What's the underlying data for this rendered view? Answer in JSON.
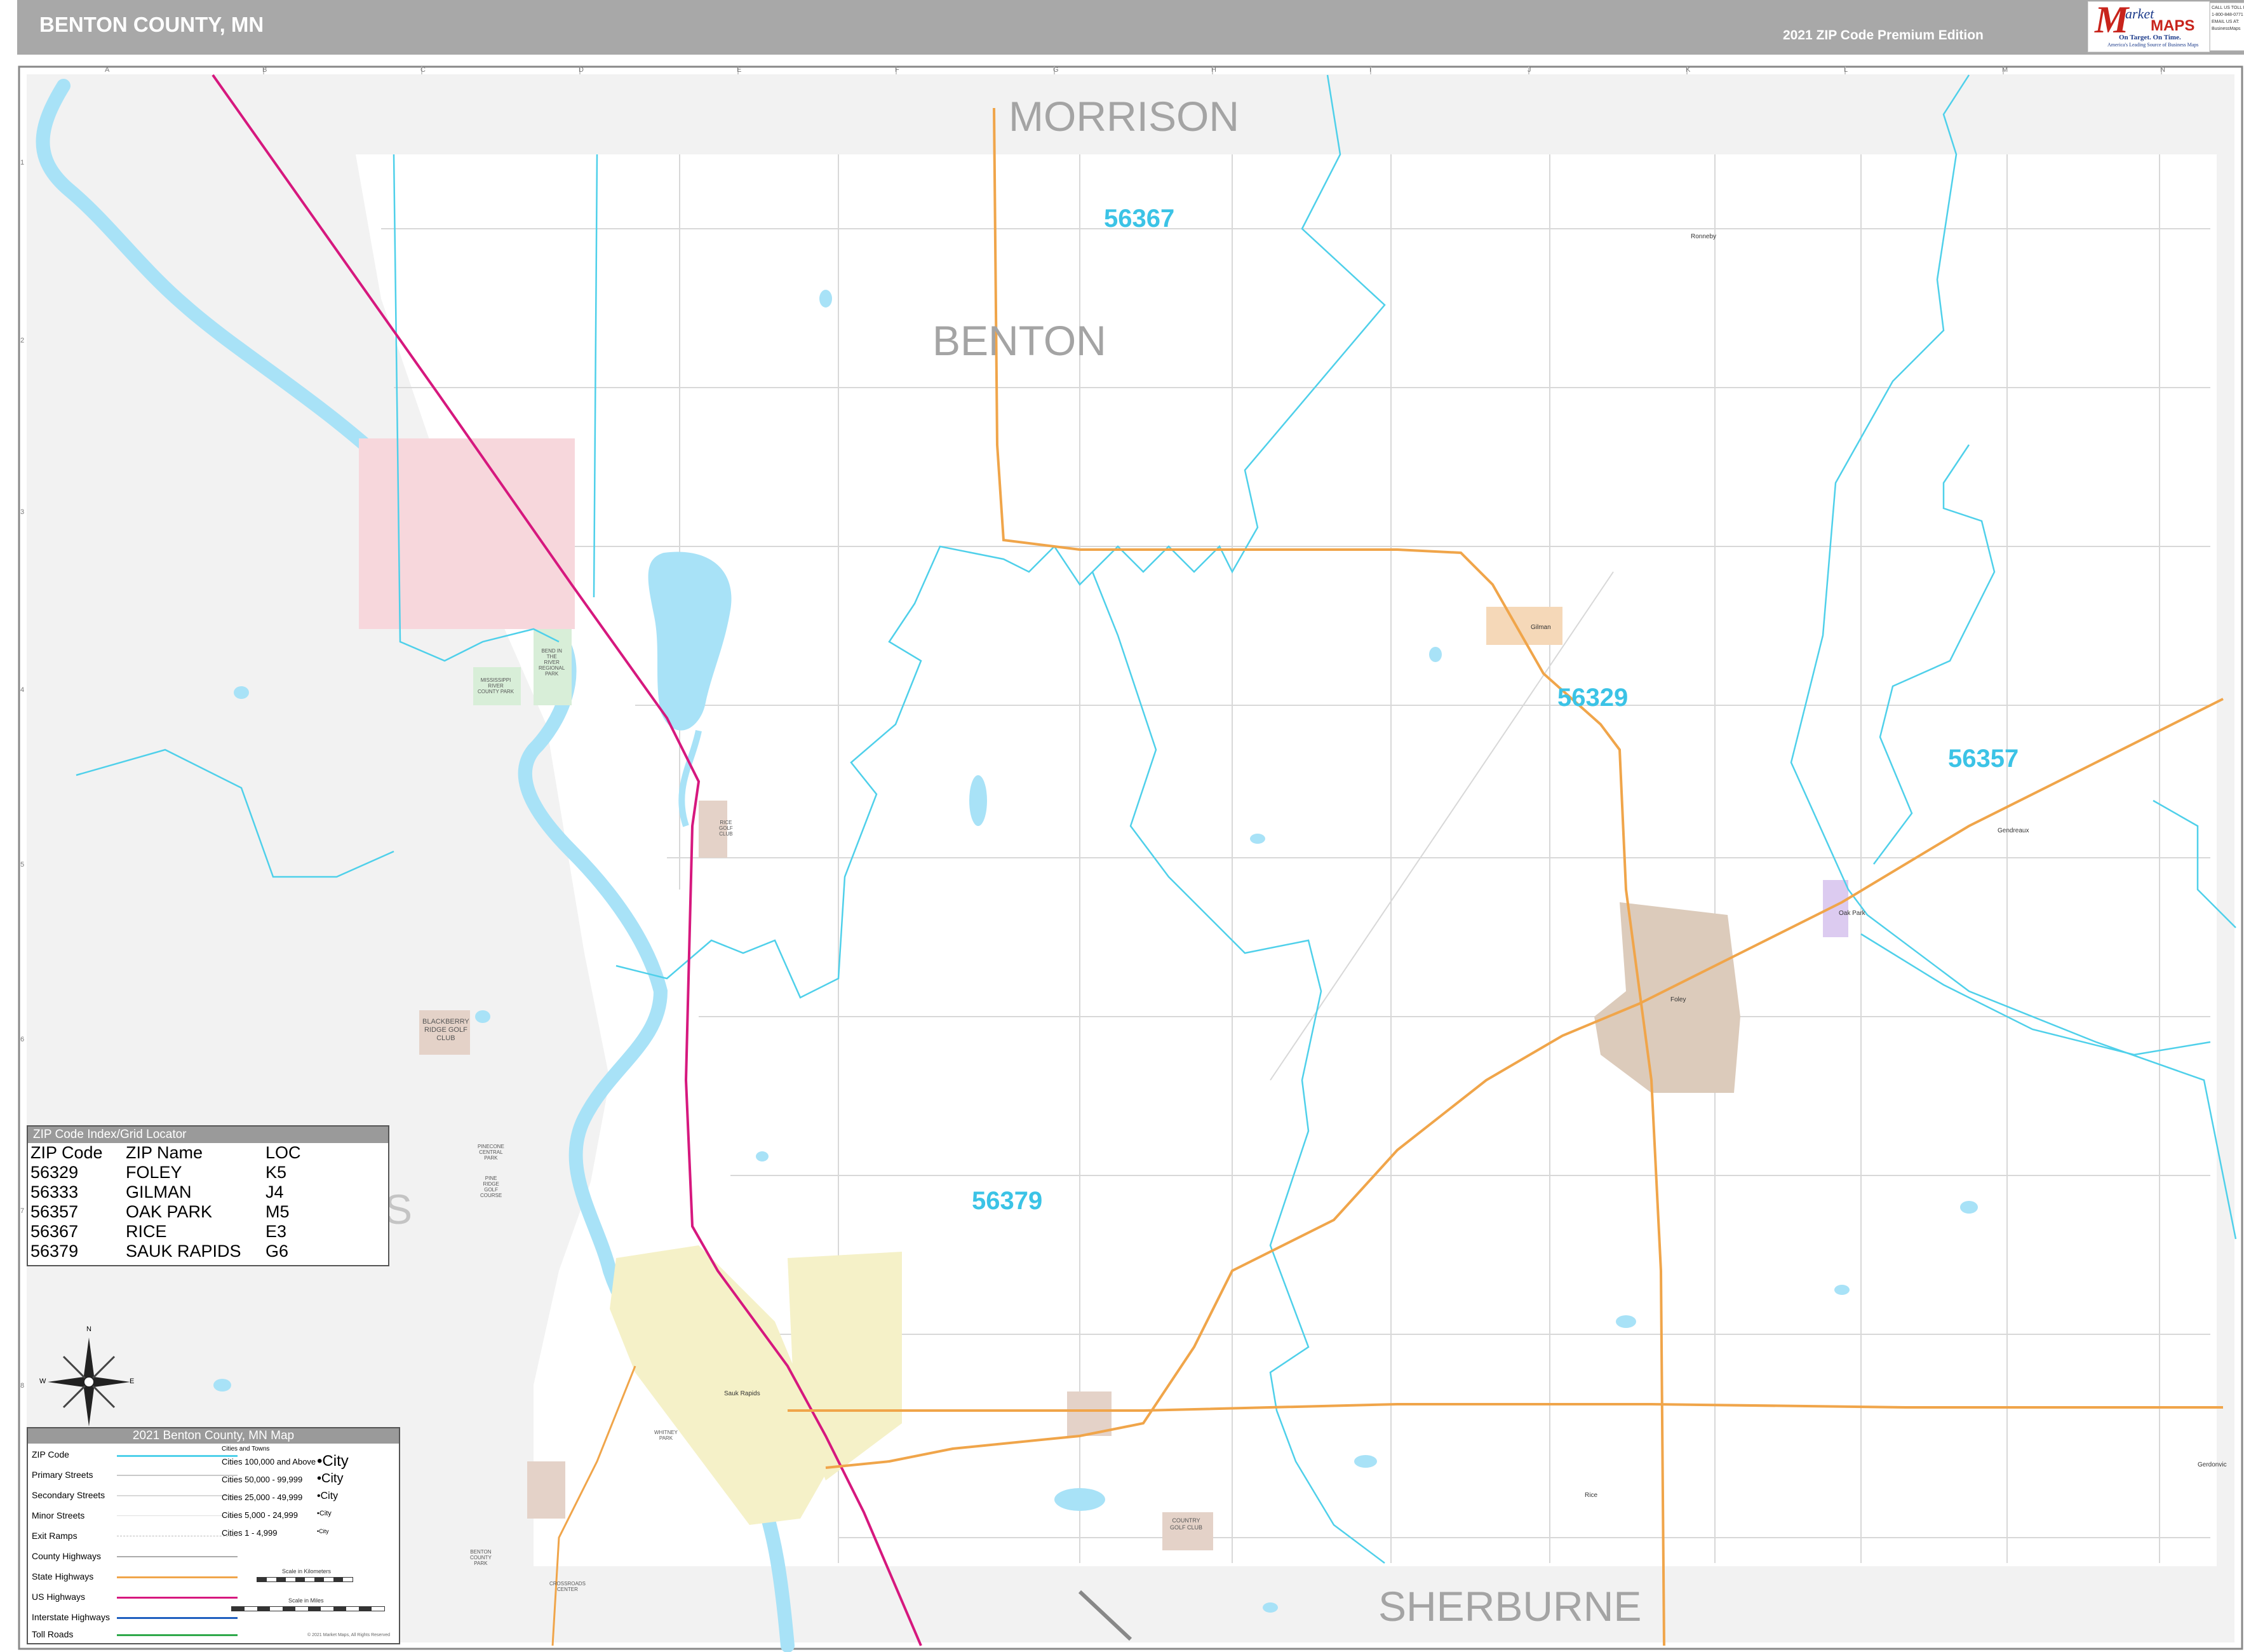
{
  "header": {
    "title": "BENTON COUNTY, MN",
    "edition": "2021 ZIP Code Premium Edition",
    "logo": {
      "m": "M",
      "arket": "arket",
      "maps": "MAPS",
      "tag1": "On Target.  On Time.",
      "tag2": "America's Leading Source of Business Maps"
    },
    "contact_lines": [
      "CALL US TOLL FREE",
      "1-800-848-0771",
      "EMAIL US AT:",
      "BusinessMaps"
    ]
  },
  "grid": {
    "columns": [
      "A",
      "B",
      "C",
      "D",
      "E",
      "F",
      "G",
      "H",
      "I",
      "J",
      "K",
      "L",
      "M",
      "N"
    ],
    "rows": [
      "1",
      "2",
      "3",
      "4",
      "5",
      "6",
      "7",
      "8"
    ]
  },
  "regions": {
    "morrison": "MORRISON",
    "benton": "BENTON",
    "sherburne": "SHERBURNE",
    "stearns_fragment": "S"
  },
  "zips": {
    "z56367": "56367",
    "z56329": "56329",
    "z56357": "56357",
    "z56379": "56379"
  },
  "places": {
    "blackberry": [
      "BLACKBERRY",
      "RIDGE GOLF",
      "CLUB"
    ],
    "sauk_rapids_town": "Sauk Rapids",
    "foley_town": "Foley",
    "gilman_town": "Gilman",
    "ronneby": "Ronneby",
    "oak_park_town": "Oak Park",
    "rice_town": "Rice",
    "gerdonvic": "Gerdonvic",
    "gendreaux": "Gendreaux",
    "country_golf": [
      "COUNTRY",
      "GOLF CLUB"
    ],
    "mississippi_park": [
      "MISSISSIPPI",
      "RIVER",
      "COUNTY PARK"
    ],
    "bend_river": [
      "BEND IN",
      "THE",
      "RIVER",
      "REGIONAL",
      "PARK"
    ],
    "pinecone": [
      "PINECONE",
      "CENTRAL",
      "PARK"
    ],
    "pine_ridge": [
      "PINE",
      "RIDGE",
      "GOLF",
      "COURSE"
    ],
    "whitney_park": [
      "WHITNEY",
      "PARK"
    ],
    "benton_park": [
      "BENTON",
      "COUNTY",
      "PARK"
    ],
    "crossroads": [
      "CROSSROADS",
      "CENTER"
    ],
    "golf_rice": [
      "RICE",
      "GOLF",
      "CLUB"
    ]
  },
  "compass": {
    "n": "N",
    "s": "S",
    "e": "E",
    "w": "W"
  },
  "index": {
    "title": "ZIP Code Index/Grid Locator",
    "headers": [
      "ZIP Code",
      "ZIP Name",
      "LOC"
    ],
    "rows": [
      [
        "56329",
        "FOLEY",
        "K5"
      ],
      [
        "56333",
        "GILMAN",
        "J4"
      ],
      [
        "56357",
        "OAK PARK",
        "M5"
      ],
      [
        "56367",
        "RICE",
        "E3"
      ],
      [
        "56379",
        "SAUK RAPIDS",
        "G6"
      ]
    ]
  },
  "legend": {
    "title": "2021 Benton County, MN Map",
    "items": [
      "ZIP Code",
      "Primary Streets",
      "Secondary Streets",
      "Minor Streets",
      "Exit Ramps",
      "County Highways",
      "State Highways",
      "US Highways",
      "Interstate Highways",
      "Toll Roads"
    ],
    "cities_title": "Cities and Towns",
    "cities": [
      [
        "Cities 100,000 and Above",
        "•City"
      ],
      [
        "Cities 50,000 - 99,999",
        "•City"
      ],
      [
        "Cities 25,000 - 49,999",
        "•City"
      ],
      [
        "Cities 5,000 - 24,999",
        "•City"
      ],
      [
        "Cities 1 - 4,999",
        "•City"
      ]
    ],
    "scale_km": "Scale in Kilometers",
    "scale_mi": "Scale in Miles",
    "copyright": "© 2021 Market Maps, All Rights Reserved"
  },
  "colors": {
    "zip_boundary": "#4fd0ea",
    "water": "#a8e2f7",
    "outside_county": "#f2f2f2",
    "us_highway": "#d6187e",
    "state_highway": "#f0a54a",
    "sauk_rapids_city": "#f5f1c8",
    "rice_city": "#f7d7dc",
    "foley_city": "#dccbbb",
    "oak_park_city": "#dccbf0",
    "zip_label": "#3bc3e6",
    "region_label": "#a4a4a4"
  }
}
